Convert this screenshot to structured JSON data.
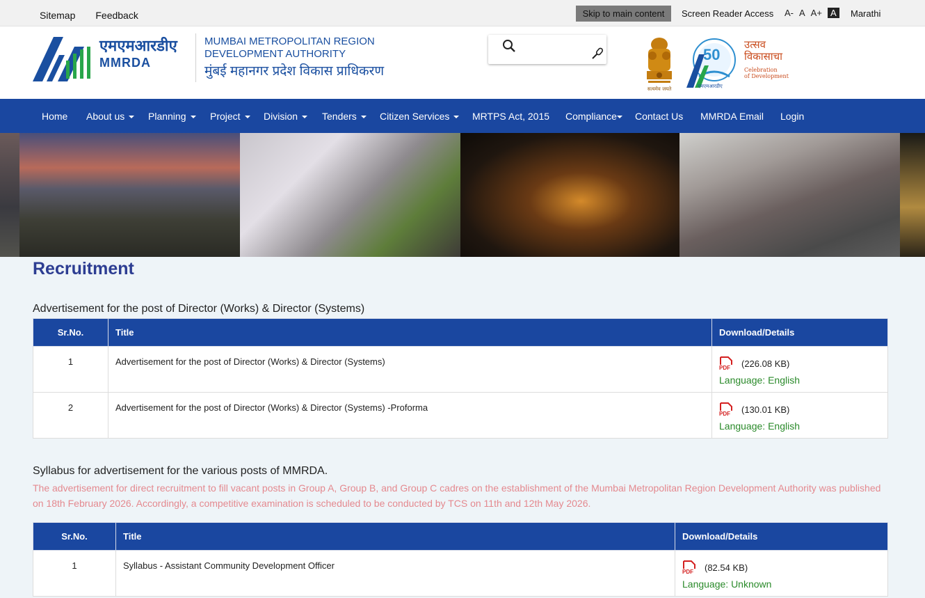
{
  "topbar": {
    "sitemap": "Sitemap",
    "feedback": "Feedback",
    "skip": "Skip to main content",
    "screen_reader": "Screen Reader Access",
    "font_minus": "A-",
    "font_normal": "A",
    "font_plus": "A+",
    "font_contrast": "A",
    "language": "Marathi"
  },
  "header": {
    "logo_hindi": "एमएमआरडीए",
    "logo_eng": "MMRDA",
    "org_name_line1": "MUMBAI METROPOLITAN REGION",
    "org_name_line2": "DEVELOPMENT AUTHORITY",
    "org_name_hindi": "मुंबई महानगर प्रदेश विकास प्राधिकरण",
    "search_placeholder": "",
    "utsav_hindi_1": "उत्सव",
    "utsav_hindi_2": "विकासाचा",
    "utsav_eng_1": "Celebration",
    "utsav_eng_2": "of Development"
  },
  "nav": {
    "items": [
      {
        "label": "Home",
        "dropdown": false
      },
      {
        "label": "About us",
        "dropdown": true
      },
      {
        "label": "Planning",
        "dropdown": true
      },
      {
        "label": "Project",
        "dropdown": true
      },
      {
        "label": "Division",
        "dropdown": true
      },
      {
        "label": "Tenders",
        "dropdown": true
      },
      {
        "label": "Citizen Services",
        "dropdown": true
      },
      {
        "label": "MRTPS Act, 2015",
        "dropdown": false
      },
      {
        "label": "Compliance",
        "dropdown": true
      },
      {
        "label": "Contact Us",
        "dropdown": false
      },
      {
        "label": "MMRDA Email",
        "dropdown": false
      },
      {
        "label": "Login",
        "dropdown": false
      }
    ]
  },
  "content": {
    "page_title": "Recruitment",
    "section1": {
      "title": "Advertisement for the post of Director (Works) & Director (Systems)",
      "headers": [
        "Sr.No.",
        "Title",
        "Download/Details"
      ],
      "rows": [
        {
          "sr": "1",
          "title": "Advertisement for the post of Director (Works) & Director (Systems)",
          "size": "(226.08 KB)",
          "language": "Language: English"
        },
        {
          "sr": "2",
          "title": "Advertisement for the post of Director (Works) & Director (Systems) -Proforma",
          "size": "(130.01 KB)",
          "language": "Language: English"
        }
      ]
    },
    "section2": {
      "title": "Syllabus for advertisement for the various posts of MMRDA.",
      "notice": "The advertisement for direct recruitment to fill vacant posts in Group A, Group B, and Group C cadres on the establishment of the Mumbai Metropolitan Region Development Authority was published on 18th February 2026. Accordingly, a competitive examination is scheduled to be conducted by TCS on 11th and 12th May 2026.",
      "headers": [
        "Sr.No.",
        "Title",
        "Download/Details"
      ],
      "rows": [
        {
          "sr": "1",
          "title": "Syllabus - Assistant Community Development Officer",
          "size": "(82.54 KB)",
          "language": "Language: Unknown"
        }
      ]
    },
    "pdf_label": "PDF"
  },
  "colors": {
    "nav_bg": "#1a47a0",
    "title": "#2d3d92",
    "notice": "#e4898f",
    "language": "#2a8a2a",
    "pdf_red": "#d42020"
  }
}
